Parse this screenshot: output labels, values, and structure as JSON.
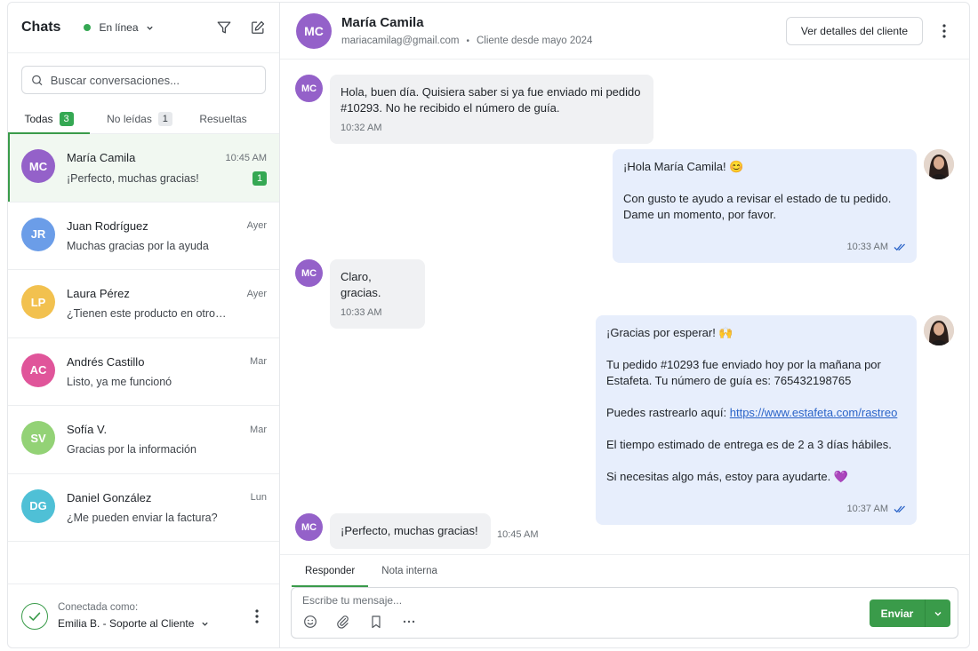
{
  "sidebar": {
    "title": "Chats",
    "status_label": "En línea",
    "search_placeholder": "Buscar conversaciones...",
    "tabs": [
      {
        "label": "Todas",
        "count": "3"
      },
      {
        "label": "No leídas",
        "count": "1"
      },
      {
        "label": "Resueltas",
        "count": ""
      }
    ],
    "chats": [
      {
        "initials": "MC",
        "name": "María Camila",
        "time": "10:45 AM",
        "preview": "¡Perfecto, muchas gracias!",
        "unread": "1",
        "color": "#9461c9"
      },
      {
        "initials": "JR",
        "name": "Juan Rodríguez",
        "time": "Ayer",
        "preview": "Muchas gracias por la ayuda",
        "unread": "",
        "color": "#6b9de8"
      },
      {
        "initials": "LP",
        "name": "Laura Pérez",
        "time": "Ayer",
        "preview": "¿Tienen este producto en otro…",
        "unread": "",
        "color": "#f2c14f"
      },
      {
        "initials": "AC",
        "name": "Andrés Castillo",
        "time": "Mar",
        "preview": "Listo, ya me funcionó",
        "unread": "",
        "color": "#e0559a"
      },
      {
        "initials": "SV",
        "name": "Sofía V.",
        "time": "Mar",
        "preview": "Gracias por la información",
        "unread": "",
        "color": "#93d276"
      },
      {
        "initials": "DG",
        "name": "Daniel González",
        "time": "Lun",
        "preview": "¿Me pueden enviar la factura?",
        "unread": "",
        "color": "#4fc0d6"
      }
    ],
    "footer": {
      "label": "Conectada como:",
      "user": "Emilia B. - Soporte al Cliente"
    }
  },
  "header": {
    "initials": "MC",
    "name": "María Camila",
    "email": "mariacamilag@gmail.com",
    "customer_since": "Cliente desde mayo 2024",
    "details_button": "Ver detalles del cliente"
  },
  "messages": [
    {
      "from": "customer",
      "lines": [
        "Hola, buen día. Quisiera saber si ya fue enviado mi pedido",
        "#10293. No he recibido el número de guía."
      ],
      "time": "10:32 AM"
    },
    {
      "from": "agent",
      "paragraphs": [
        "¡Hola María Camila! 😊",
        "Con gusto te ayudo a revisar el estado de tu pedido.\nDame un momento, por favor."
      ],
      "time": "10:33 AM"
    },
    {
      "from": "customer",
      "lines": [
        "Claro, gracias."
      ],
      "time": "10:33 AM"
    },
    {
      "from": "agent",
      "paragraphs": [
        "¡Gracias por esperar! 🙌",
        "Tu pedido #10293 fue enviado hoy por la mañana por\nEstafeta. Tu número de guía es: 765432198765",
        "Puedes rastrearlo aquí: ",
        "El tiempo estimado de entrega es de 2 a 3 días hábiles.",
        "Si necesitas algo más, estoy para ayudarte. 💜"
      ],
      "link": "https://www.estafeta.com/rastreo",
      "time": "10:37 AM"
    },
    {
      "from": "customer",
      "lines": [
        "¡Perfecto, muchas gracias!"
      ],
      "time": "10:45 AM"
    }
  ],
  "composer": {
    "tabs": [
      "Responder",
      "Nota interna"
    ],
    "placeholder": "Escribe tu mensaje...",
    "send_label": "Enviar"
  },
  "colors": {
    "accent": "#3a9b4a",
    "customer_avatar": "#9461c9",
    "agent_bubble": "#e7eefc",
    "customer_bubble": "#f0f1f3"
  }
}
